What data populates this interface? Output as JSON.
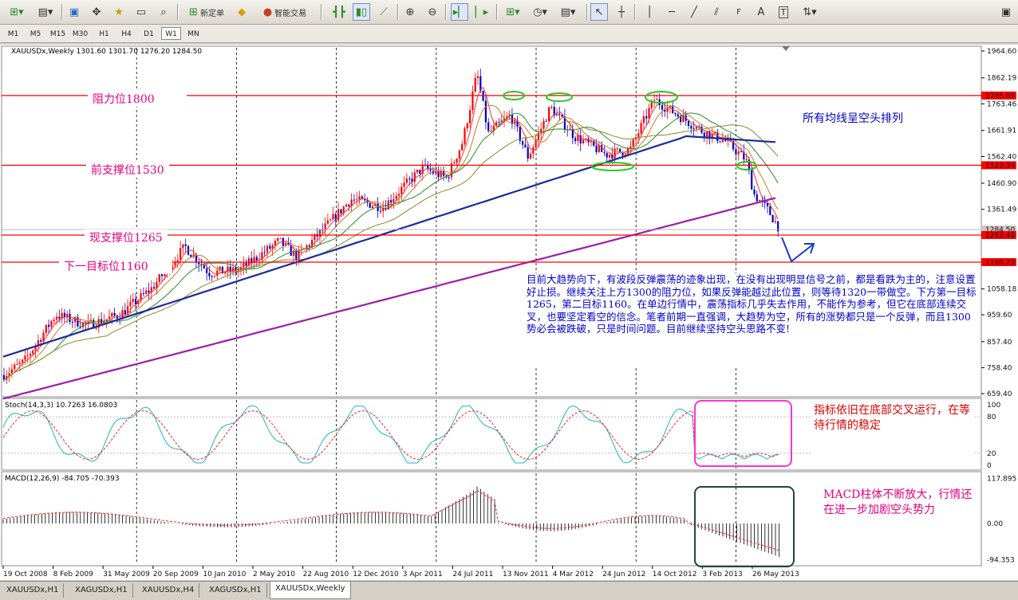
{
  "toolbar": {
    "new_order_label": "新定单",
    "expert_label": "智能交易"
  },
  "timeframes": [
    "M1",
    "M5",
    "M15",
    "M30",
    "H1",
    "H4",
    "D1",
    "W1",
    "MN"
  ],
  "active_timeframe": "W1",
  "chart": {
    "symbol_info": "XAUUSDx,Weekly  1301.60 1301.70 1276.20 1284.50",
    "price_axis": [
      "1964.60",
      "1862.19",
      "1763.46",
      "1661.91",
      "1562.40",
      "1460.90",
      "1361.49",
      "1259.20",
      "1158.69",
      "1058.18",
      "959.60",
      "857.40",
      "758.40",
      "659.40"
    ],
    "date_axis": [
      "19 Oct 2008",
      "8 Feb 2009",
      "31 May 2009",
      "20 Sep 2009",
      "10 Jan 2010",
      "2 May 2010",
      "22 Aug 2010",
      "12 Dec 2010",
      "3 Apr 2011",
      "24 Jul 2011",
      "13 Nov 2011",
      "4 Mar 2012",
      "24 Jun 2012",
      "14 Oct 2012",
      "3 Feb 2013",
      "26 May 2013"
    ],
    "price_tags": {
      "resistance": "1795.09",
      "prev_support": "1529.34",
      "last_price": "1284.50",
      "curr_support": "1263.49",
      "target": "1160.29"
    },
    "levels": {
      "resistance": {
        "label": "阻力位1800",
        "price": 1795.09
      },
      "prev_support": {
        "label": "前支撑位1530",
        "price": 1529.34
      },
      "curr_support": {
        "label": "现支撑位1265",
        "price": 1263.49
      },
      "target": {
        "label": "下一目标位1160",
        "price": 1160.29
      }
    },
    "ma_note": "所有均线呈空头排列",
    "main_comment": "目前大趋势向下，有波段反弹震荡的迹象出现，在没有出现明显信号之前，都是看跌为主的，注意设置好止损。继续关注上方1300的阻力位，如果反弹能越过此位置，则等待1320一带做空。下方第一目标1265，第二目标1160。在单边行情中，震荡指标几乎失去作用，不能作为参考，但它在底部连续交叉，也要坚定看空的信念。笔者前期一直强调，大趋势为空，所有的涨势都只是一个反弹，而且1300势必会被跌破，只是时间问题。目前继续坚持空头思路不变!"
  },
  "stoch": {
    "header": "Stoch(14,3,3) 10.7263 16.0803",
    "axis": [
      "100",
      "80",
      "20",
      "0"
    ],
    "comment": "指标依旧在底部交叉运行，在等待行情的稳定"
  },
  "macd": {
    "header": "MACD(12,26,9) -84.705 -70.393",
    "axis": [
      "117.895",
      "0.00",
      "-94.353"
    ],
    "comment": "MACD柱体不断放大，行情还在进一步加剧空头势力"
  },
  "tabs": [
    "XAUUSDx,H1",
    "XAGUSDx,H1",
    "XAUUSDx,H4",
    "XAGUSDx,H1",
    "XAUUSDx,Weekly"
  ],
  "active_tab": "XAUUSDx,Weekly",
  "colors": {
    "level_line": "#ff0000",
    "annotation_text": "#e6007e",
    "comment_text": "#0000cc",
    "ma_long": "#9b1fa8",
    "ma_mid": "#1a2a9c",
    "bull_candle": "#ff0000",
    "bear_candle": "#0000cc"
  }
}
